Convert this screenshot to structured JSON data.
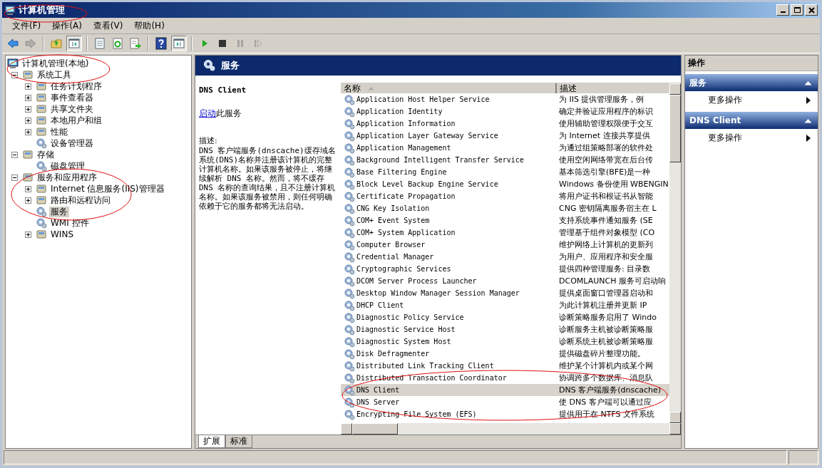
{
  "window": {
    "title": "计算机管理"
  },
  "menu": [
    "文件(F)",
    "操作(A)",
    "查看(V)",
    "帮助(H)"
  ],
  "toolbar": [
    {
      "kind": "back",
      "disabled": false
    },
    {
      "kind": "forward",
      "disabled": true
    },
    {
      "kind": "separator"
    },
    {
      "kind": "up",
      "disabled": false
    },
    {
      "kind": "tree-toggle",
      "disabled": false,
      "pressed": true
    },
    {
      "kind": "separator"
    },
    {
      "kind": "properties",
      "disabled": false
    },
    {
      "kind": "refresh",
      "disabled": false
    },
    {
      "kind": "export",
      "disabled": false
    },
    {
      "kind": "separator"
    },
    {
      "kind": "help",
      "disabled": false
    },
    {
      "kind": "pane-toggle",
      "disabled": false,
      "pressed": true
    },
    {
      "kind": "separator"
    },
    {
      "kind": "start",
      "disabled": false
    },
    {
      "kind": "stop",
      "disabled": false
    },
    {
      "kind": "pause",
      "disabled": true
    },
    {
      "kind": "restart",
      "disabled": true
    }
  ],
  "tree": [
    {
      "label": "计算机管理(本地)",
      "kind": "root",
      "selected": false,
      "children": [
        {
          "label": "系统工具",
          "kind": "branch",
          "expanded": true,
          "selected": false,
          "children": [
            {
              "label": "任务计划程序",
              "kind": "branch",
              "expanded": false,
              "selected": false
            },
            {
              "label": "事件查看器",
              "kind": "branch",
              "expanded": false,
              "selected": false
            },
            {
              "label": "共享文件夹",
              "kind": "branch",
              "expanded": false,
              "selected": false
            },
            {
              "label": "本地用户和组",
              "kind": "branch",
              "expanded": false,
              "selected": false
            },
            {
              "label": "性能",
              "kind": "branch",
              "expanded": false,
              "selected": false
            },
            {
              "label": "设备管理器",
              "kind": "leaf",
              "selected": false
            }
          ]
        },
        {
          "label": "存储",
          "kind": "branch",
          "expanded": true,
          "selected": false,
          "children": [
            {
              "label": "磁盘管理",
              "kind": "leaf",
              "selected": false
            }
          ]
        },
        {
          "label": "服务和应用程序",
          "kind": "branch",
          "expanded": true,
          "selected": false,
          "children": [
            {
              "label": "Internet 信息服务(IIS)管理器",
              "kind": "branch",
              "expanded": false,
              "selected": false
            },
            {
              "label": "路由和远程访问",
              "kind": "branch",
              "expanded": false,
              "selected": false
            },
            {
              "label": "服务",
              "kind": "leaf",
              "selected": true
            },
            {
              "label": "WMI 控件",
              "kind": "leaf",
              "selected": false
            },
            {
              "label": "WINS",
              "kind": "branch",
              "expanded": false,
              "selected": false
            }
          ]
        }
      ]
    }
  ],
  "center": {
    "header": "服务",
    "details": {
      "service_name": "DNS Client",
      "action_link": "启动",
      "action_text": "此服务",
      "description_label": "描述:",
      "description": "DNS 客户端服务(dnscache)缓存域名系统(DNS)名称并注册该计算机的完整计算机名称。如果该服务被停止，将继续解析 DNS 名称。然而，将不缓存 DNS 名称的查询结果，且不注册计算机名称。如果该服务被禁用，则任何明确依赖于它的服务都将无法启动。"
    },
    "table": {
      "columns": [
        "名称",
        "描述"
      ],
      "rows": [
        {
          "name": "Application Host Helper Service",
          "description": "为 IIS 提供管理服务，例",
          "selected": false
        },
        {
          "name": "Application Identity",
          "description": "确定并验证应用程序的标识",
          "selected": false
        },
        {
          "name": "Application Information",
          "description": "使用辅助管理权限便于交互",
          "selected": false
        },
        {
          "name": "Application Layer Gateway Service",
          "description": "为 Internet 连接共享提供",
          "selected": false
        },
        {
          "name": "Application Management",
          "description": "为通过组策略部署的软件处",
          "selected": false
        },
        {
          "name": "Background Intelligent Transfer Service",
          "description": "使用空闲网络带宽在后台传",
          "selected": false
        },
        {
          "name": "Base Filtering Engine",
          "description": "基本筛选引擎(BFE)是一种",
          "selected": false
        },
        {
          "name": "Block Level Backup Engine Service",
          "description": "Windows 备份使用 WBENGIN",
          "selected": false
        },
        {
          "name": "Certificate Propagation",
          "description": "将用户证书和根证书从智能",
          "selected": false
        },
        {
          "name": "CNG Key Isolation",
          "description": "CNG 密钥隔离服务宿主在 L",
          "selected": false
        },
        {
          "name": "COM+ Event System",
          "description": "支持系统事件通知服务 (SE",
          "selected": false
        },
        {
          "name": "COM+ System Application",
          "description": "管理基于组件对象模型 (CO",
          "selected": false
        },
        {
          "name": "Computer Browser",
          "description": "维护网络上计算机的更新列",
          "selected": false
        },
        {
          "name": "Credential Manager",
          "description": "为用户、应用程序和安全服",
          "selected": false
        },
        {
          "name": "Cryptographic Services",
          "description": "提供四种管理服务: 目录数",
          "selected": false
        },
        {
          "name": "DCOM Server Process Launcher",
          "description": "DCOMLAUNCH 服务可启动响",
          "selected": false
        },
        {
          "name": "Desktop Window Manager Session Manager",
          "description": "提供桌面窗口管理器启动和",
          "selected": false
        },
        {
          "name": "DHCP Client",
          "description": "为此计算机注册并更新 IP",
          "selected": false
        },
        {
          "name": "Diagnostic Policy Service",
          "description": "诊断策略服务启用了 Windo",
          "selected": false
        },
        {
          "name": "Diagnostic Service Host",
          "description": "诊断服务主机被诊断策略服",
          "selected": false
        },
        {
          "name": "Diagnostic System Host",
          "description": "诊断系统主机被诊断策略服",
          "selected": false
        },
        {
          "name": "Disk Defragmenter",
          "description": "提供磁盘碎片整理功能。",
          "selected": false
        },
        {
          "name": "Distributed Link Tracking Client",
          "description": "维护某个计算机内或某个网",
          "selected": false
        },
        {
          "name": "Distributed Transaction Coordinator",
          "description": "协调跨多个数据库、消息队",
          "selected": false
        },
        {
          "name": "DNS Client",
          "description": "DNS 客户端服务(dnscache)",
          "selected": true
        },
        {
          "name": "DNS Server",
          "description": "使 DNS 客户端可以通过应",
          "selected": false
        },
        {
          "name": "Encrypting File System (EFS)",
          "description": "提供用于在 NTFS 文件系统",
          "selected": false
        }
      ]
    },
    "tabs": [
      {
        "label": "扩展",
        "selected": true
      },
      {
        "label": "标准",
        "selected": false
      }
    ]
  },
  "actions": {
    "title": "操作",
    "sections": [
      {
        "title": "服务",
        "expanded": true,
        "items": [
          "更多操作"
        ]
      },
      {
        "title": "DNS Client",
        "expanded": true,
        "items": [
          "更多操作"
        ]
      }
    ]
  }
}
